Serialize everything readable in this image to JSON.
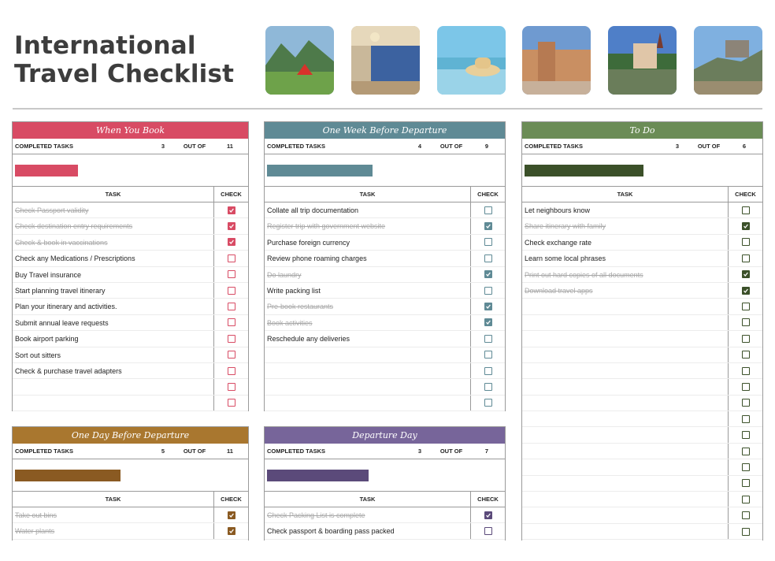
{
  "title": {
    "line1": "International",
    "line2": "Travel Checklist"
  },
  "photos": [
    "tent-mountains-photo",
    "palace-hall-photo",
    "beach-car-hat-photo",
    "castle-square-photo",
    "lake-castle-photo",
    "hill-castle-photo"
  ],
  "labels": {
    "completed": "COMPLETED TASKS",
    "out_of": "OUT OF",
    "task": "TASK",
    "check": "CHECK"
  },
  "panels": {
    "book": {
      "title": "When You Book",
      "color": "#d84b64",
      "done": "3",
      "total": "11",
      "progress": 0.2727,
      "tasks": [
        {
          "text": "Check Passport validity",
          "done": true
        },
        {
          "text": "Check destination entry requirements",
          "done": true
        },
        {
          "text": "Check & book in vaccinations",
          "done": true
        },
        {
          "text": "Check any Medications / Prescriptions",
          "done": false
        },
        {
          "text": "Buy Travel insurance",
          "done": false
        },
        {
          "text": "Start planning travel itinerary",
          "done": false
        },
        {
          "text": "Plan your itinerary and activities.",
          "done": false
        },
        {
          "text": "Submit annual leave requests",
          "done": false
        },
        {
          "text": "Book airport parking",
          "done": false
        },
        {
          "text": "Sort out sitters",
          "done": false
        },
        {
          "text": "Check & purchase travel adapters",
          "done": false
        },
        {
          "text": "",
          "done": false
        },
        {
          "text": "",
          "done": false
        }
      ]
    },
    "week": {
      "title": "One Week Before Departure",
      "color": "#5f8a95",
      "done": "4",
      "total": "9",
      "progress": 0.444,
      "tasks": [
        {
          "text": "Collate all trip documentation",
          "done": false
        },
        {
          "text": "Register trip with government website",
          "done": true
        },
        {
          "text": "Purchase foreign currency",
          "done": false
        },
        {
          "text": "Review phone roaming charges",
          "done": false
        },
        {
          "text": "Do laundry",
          "done": true
        },
        {
          "text": "Write packing list",
          "done": false
        },
        {
          "text": "Pre-book restaurants",
          "done": true
        },
        {
          "text": "Book activities",
          "done": true
        },
        {
          "text": "Reschedule any deliveries",
          "done": false
        },
        {
          "text": "",
          "done": false
        },
        {
          "text": "",
          "done": false
        },
        {
          "text": "",
          "done": false
        },
        {
          "text": "",
          "done": false
        }
      ]
    },
    "todo": {
      "title": "To Do",
      "color": "#6b8c56",
      "bar_color": "#3b5029",
      "done": "3",
      "total": "6",
      "progress": 0.5,
      "tasks": [
        {
          "text": "Let neighbours know",
          "done": false
        },
        {
          "text": "Share itinerary with family",
          "done": true
        },
        {
          "text": "Check exchange rate",
          "done": false
        },
        {
          "text": "Learn some local phrases",
          "done": false
        },
        {
          "text": "Print out hard copies of all documents",
          "done": true
        },
        {
          "text": "Download travel apps",
          "done": true
        },
        {
          "text": "",
          "done": false
        },
        {
          "text": "",
          "done": false
        },
        {
          "text": "",
          "done": false
        },
        {
          "text": "",
          "done": false
        },
        {
          "text": "",
          "done": false
        },
        {
          "text": "",
          "done": false
        },
        {
          "text": "",
          "done": false
        },
        {
          "text": "",
          "done": false
        },
        {
          "text": "",
          "done": false
        },
        {
          "text": "",
          "done": false
        },
        {
          "text": "",
          "done": false
        },
        {
          "text": "",
          "done": false
        },
        {
          "text": "",
          "done": false
        },
        {
          "text": "",
          "done": false
        },
        {
          "text": "",
          "done": false
        }
      ]
    },
    "day": {
      "title": "One Day Before Departure",
      "color": "#a9772f",
      "bar_color": "#8a5a22",
      "done": "5",
      "total": "11",
      "progress": 0.4545,
      "tasks": [
        {
          "text": "Take out bins",
          "done": true
        },
        {
          "text": "Water plants",
          "done": true
        }
      ]
    },
    "departure": {
      "title": "Departure Day",
      "color": "#77659a",
      "bar_color": "#5b4a7a",
      "done": "3",
      "total": "7",
      "progress": 0.4286,
      "tasks": [
        {
          "text": "Check Packing List is complete",
          "done": true
        },
        {
          "text": "Check passport & boarding pass packed",
          "done": false
        }
      ]
    }
  }
}
